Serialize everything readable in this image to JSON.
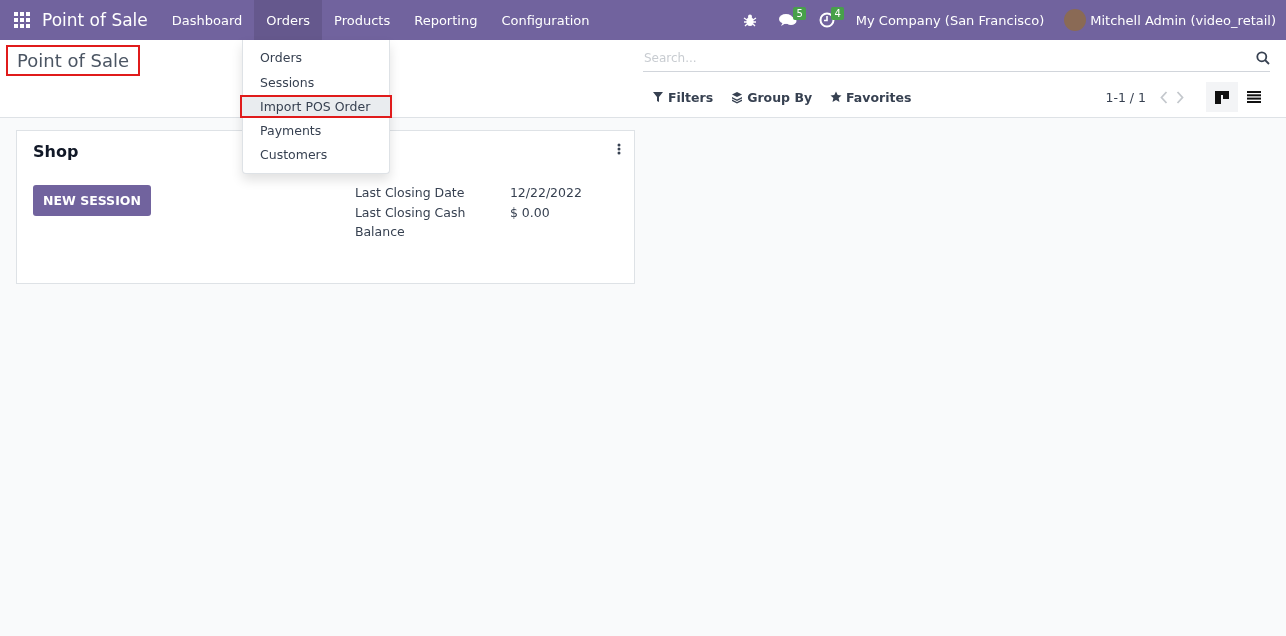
{
  "navbar": {
    "app_name": "Point of Sale",
    "menus": [
      {
        "label": "Dashboard",
        "selected": false
      },
      {
        "label": "Orders",
        "selected": true
      },
      {
        "label": "Products",
        "selected": false
      },
      {
        "label": "Reporting",
        "selected": false
      },
      {
        "label": "Configuration",
        "selected": false
      }
    ],
    "messages_badge": "5",
    "activities_badge": "4",
    "company": "My Company (San Francisco)",
    "user": "Mitchell Admin (video_retail)"
  },
  "dropdown": {
    "items": [
      {
        "label": "Orders",
        "highlighted": false
      },
      {
        "label": "Sessions",
        "highlighted": false
      },
      {
        "label": "Import POS Order",
        "highlighted": true
      },
      {
        "label": "Payments",
        "highlighted": false
      },
      {
        "label": "Customers",
        "highlighted": false
      }
    ]
  },
  "control_panel": {
    "breadcrumb": {
      "label": "Point of Sale",
      "highlighted": true
    },
    "search": {
      "placeholder": "Search..."
    },
    "filters": [
      {
        "label": "Filters",
        "kind": "filter"
      },
      {
        "label": "Group By",
        "kind": "group"
      },
      {
        "label": "Favorites",
        "kind": "star"
      }
    ],
    "pager": "1-1 / 1",
    "views": [
      {
        "kind": "kanban",
        "selected": true
      },
      {
        "kind": "list",
        "selected": false
      }
    ]
  },
  "cards": [
    {
      "title": "Shop",
      "button": "NEW SESSION",
      "fields": [
        {
          "label": "Last Closing Date",
          "value": "12/22/2022"
        },
        {
          "label": "Last Closing Cash Balance",
          "value": "$ 0.00"
        }
      ]
    }
  ]
}
